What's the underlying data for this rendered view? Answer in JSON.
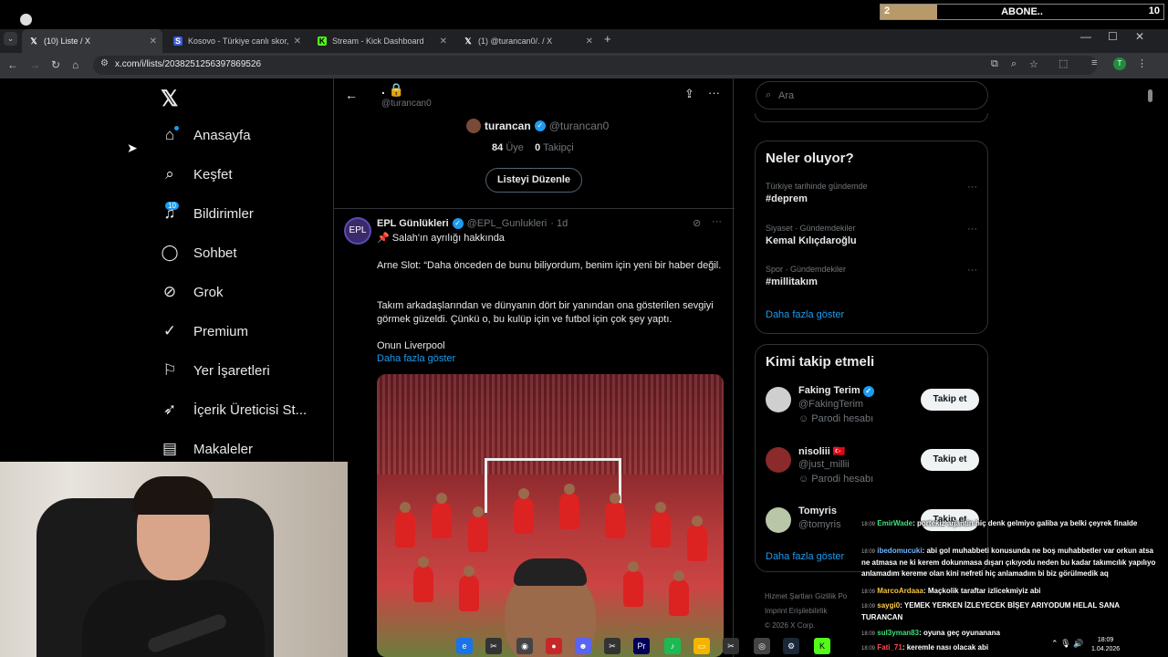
{
  "stream": {
    "subscribe_level": "2",
    "subscribe_label": "ABONE..",
    "subscribe_count": "10",
    "subscribe_progress": 0.2
  },
  "browser": {
    "tabs": [
      {
        "title": "(10) Liste / X",
        "icon": "x-logo-icon",
        "active": true
      },
      {
        "title": "Kosovo - Türkiye canlı skor, baş",
        "icon": "sofascore-icon",
        "active": false
      },
      {
        "title": "Stream - Kick Dashboard",
        "icon": "kick-icon",
        "active": false
      },
      {
        "title": "(1) @turancan0/. / X",
        "icon": "x-logo-icon",
        "active": false
      }
    ],
    "url": "x.com/i/lists/2038251256397869526"
  },
  "sidebar": {
    "items": [
      {
        "label": "Anasayfa",
        "icon": "home-icon"
      },
      {
        "label": "Keşfet",
        "icon": "search-icon"
      },
      {
        "label": "Bildirimler",
        "icon": "bell-icon"
      },
      {
        "label": "Sohbet",
        "icon": "chat-icon"
      },
      {
        "label": "Grok",
        "icon": "grok-icon"
      },
      {
        "label": "Premium",
        "icon": "verified-icon"
      },
      {
        "label": "Yer İşaretleri",
        "icon": "bookmark-icon"
      },
      {
        "label": "İçerik Üreticisi St...",
        "icon": "rocket-icon"
      },
      {
        "label": "Makaleler",
        "icon": "article-icon"
      }
    ],
    "notification_count": "10"
  },
  "list": {
    "name": ".",
    "handle": "@turancan0",
    "owner_name": "turancan",
    "owner_handle": "@turancan0",
    "members_count": "84",
    "members_label": "Üye",
    "followers_count": "0",
    "followers_label": "Takipçi",
    "edit_label": "Listeyi Düzenle"
  },
  "tweet": {
    "author": "EPL Günlükleri",
    "handle": "@EPL_Gunlukleri",
    "time": "· 1d",
    "lines": [
      "📌 Salah'ın ayrılığı hakkında",
      "Arne Slot: “Daha önceden de bunu biliyordum, benim için yeni bir haber değil.",
      "Takım arkadaşlarından ve dünyanın dört bir yanından ona gösterilen sevgiyi görmek güzeldi. Çünkü o, bu kulüp için ve futbol için çok şey yaptı.",
      "Onun Liverpool"
    ],
    "show_more": "Daha fazla göster"
  },
  "search": {
    "placeholder": "Ara"
  },
  "trends": {
    "title": "Neler oluyor?",
    "items": [
      {
        "context": "Türkiye tarihinde gündemde",
        "topic": "#deprem"
      },
      {
        "context": "Siyaset · Gündemdekiler",
        "topic": "Kemal Kılıçdaroğlu"
      },
      {
        "context": "Spor · Gündemdekiler",
        "topic": "#millitakım"
      }
    ],
    "show_more": "Daha fazla göster"
  },
  "who_to_follow": {
    "title": "Kimi takip etmeli",
    "items": [
      {
        "name": "Faking Terim",
        "handle": "@FakingTerim",
        "label": "Parodi hesabı",
        "button": "Takip et"
      },
      {
        "name": "nisoliii 🇹🇷",
        "handle": "@just_millii",
        "label": "Parodi hesabı",
        "button": "Takip et"
      },
      {
        "name": "Tomyris",
        "handle": "@tomyris",
        "label": "",
        "button": "Takip et"
      }
    ],
    "show_more": "Daha fazla göster"
  },
  "footer": {
    "line1": "Hizmet Şartları   Gizlilik Po",
    "line2": "Imprint   Erişilebilirlik",
    "line3": "© 2026 X Corp."
  },
  "chat": [
    {
      "time": "18:09",
      "user": "EmirWade",
      "user_color": "#3ee07a",
      "text": ": portekiz arjantin hiç denk gelmiyo galiba ya belki çeyrek finalde"
    },
    {
      "time": "18:09",
      "user": "ibedomucuki",
      "user_color": "#6fb6ff",
      "text": ": abi gol muhabbeti konusunda ne boş muhabbetler var orkun atsa ne atmasa ne ki kerem dokunmasa dışarı çıkıyodu neden bu kadar takımcılık yapılıyo anlamadım kereme olan kini nefreti hiç anlamadım bi biz görülmedik aq"
    },
    {
      "time": "18:09",
      "user": "MarcoArdaaa",
      "user_color": "#f5c542",
      "text": ": Maçkolik taraftar izlicekmiyiz abi"
    },
    {
      "time": "18:09",
      "user": "saygi0",
      "user_color": "#ffcf4d",
      "text": ": YEMEK YERKEN İZLEYECEK BİŞEY ARIYODUM HELAL SANA TURANCAN"
    },
    {
      "time": "18:09",
      "user": "sul3yman83",
      "user_color": "#3ee07a",
      "text": ": oyuna geç oyunanana"
    },
    {
      "time": "18:09",
      "user": "Fati_71",
      "user_color": "#ff4d4d",
      "text": ": keremle nası olacak abi"
    }
  ],
  "taskbar": {
    "time": "18:09",
    "date": "1.04.2026"
  },
  "colors": {
    "accent": "#1d9bf0",
    "background": "#000000",
    "border": "#2f3336"
  }
}
